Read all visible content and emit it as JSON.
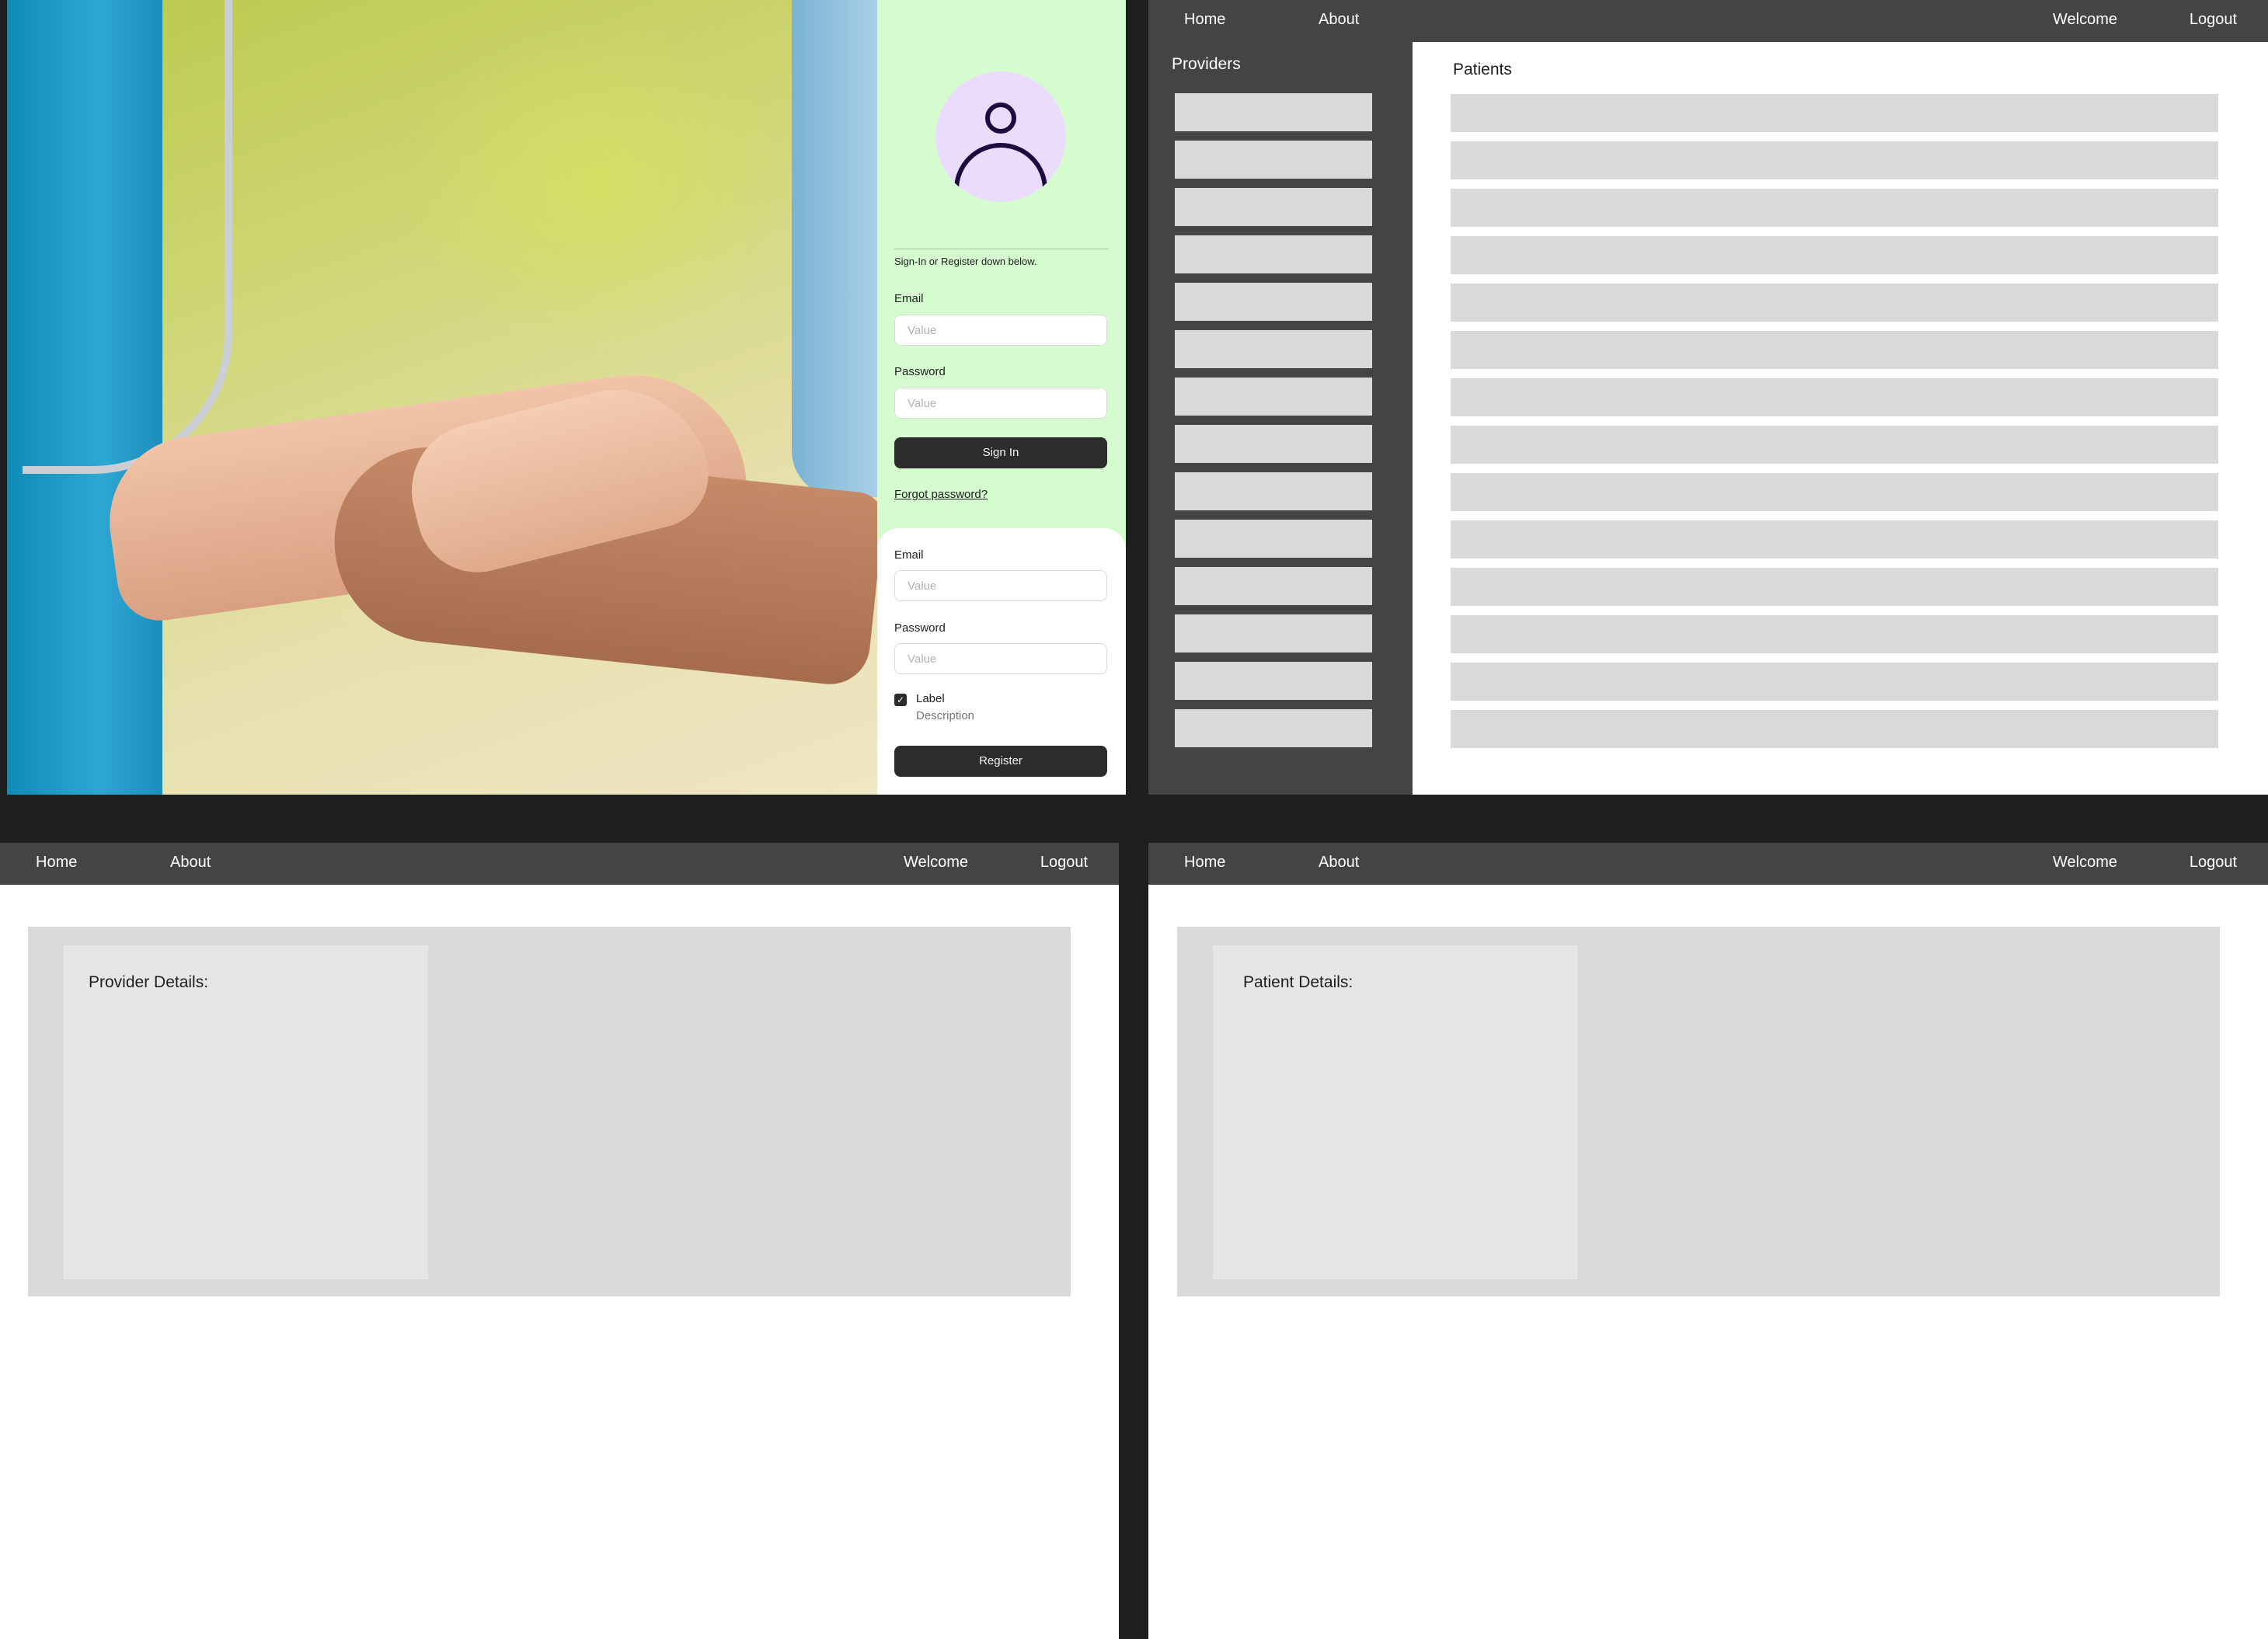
{
  "auth": {
    "intro": "Sign-In or Register down below.",
    "signin": {
      "email_label": "Email",
      "email_placeholder": "Value",
      "password_label": "Password",
      "password_placeholder": "Value",
      "button": "Sign In",
      "forgot": "Forgot password?"
    },
    "register": {
      "email_label": "Email",
      "email_placeholder": "Value",
      "password_label": "Password",
      "password_placeholder": "Value",
      "checkbox_label": "Label",
      "checkbox_description": "Description",
      "checkbox_checked": true,
      "button": "Register"
    },
    "colors": {
      "panel": "#d5fccf",
      "avatar": "#ebdcfc",
      "button": "#2c2c2c"
    },
    "icons": {
      "avatar": "user-avatar-icon",
      "checkbox": "checkmark-icon"
    }
  },
  "nav": {
    "home": "Home",
    "about": "About",
    "welcome": "Welcome",
    "logout": "Logout"
  },
  "dashboard": {
    "providers_title": "Providers",
    "patients_title": "Patients",
    "provider_rows": 14,
    "patient_rows": 14
  },
  "provider_details": {
    "title": "Provider Details:"
  },
  "patient_details": {
    "title": "Patient Details:"
  }
}
